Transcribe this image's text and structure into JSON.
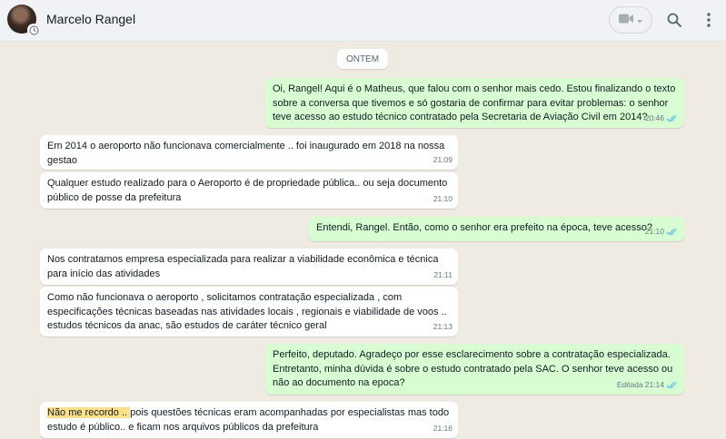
{
  "contact": {
    "name": "Marcelo Rangel"
  },
  "icons": {
    "video": "video-camera-icon",
    "chevron": "chevron-down-icon",
    "search": "search-icon",
    "menu": "kebab-menu-icon",
    "status": "clock-status-icon",
    "read": "double-check-icon"
  },
  "colors": {
    "incoming": "#ffffff",
    "outgoing": "#d9fdd3",
    "read_ticks": "#53bdeb",
    "highlight": "#ffe08a"
  },
  "date_label": "ONTEM",
  "messages": [
    {
      "dir": "out",
      "text": "Oi, Rangel! Aqui é o Matheus, que falou com o senhor mais cedo. Estou finalizando o texto sobre a conversa que tivemos e só gostaria de confirmar para evitar problemas: o senhor teve acesso ao estudo técnico contratado pela Secretaria de Aviação Civil em 2014?",
      "time": "20:46"
    },
    {
      "dir": "in",
      "text": "Em 2014 o aeroporto não funcionava comercialmente .. foi inaugurado em 2018 na nossa gestao",
      "time": "21:09"
    },
    {
      "dir": "in",
      "text": "Qualquer estudo realizado para o Aeroporto é de propriedade pública.. ou seja documento público de posse da prefeitura",
      "time": "21:10"
    },
    {
      "dir": "out",
      "text": "Entendi, Rangel. Então, como o senhor era prefeito na época, teve acesso?",
      "time": "21:10"
    },
    {
      "dir": "in",
      "text": "Nos contratamos empresa especializada para realizar a viabilidade econômica e técnica para início das atividades",
      "time": "21:11"
    },
    {
      "dir": "in",
      "text": "Como não funcionava o aeroporto , solicitamos contratação especializada , com especificações técnicas baseadas nas atividades locais , regionais e viabilidade de voos .. estudos técnicos da anac, são estudos de caráter técnico geral",
      "time": "21:13"
    },
    {
      "dir": "out",
      "text": "Perfeito, deputado. Agradeço por esse esclarecimento sobre a contratação especializada. Entretanto, minha dúvida é sobre o estudo contratado pela SAC. O senhor teve acesso ou não ao documento na epoca?",
      "time": "21:14",
      "edited": "Editada"
    },
    {
      "dir": "in",
      "highlight": "Não me recordo .. ",
      "text": "pois questões técnicas eram acompanhadas por especialistas  mas todo estudo é público.. e ficam nos arquivos públicos da prefeitura",
      "time": "21:16"
    }
  ]
}
